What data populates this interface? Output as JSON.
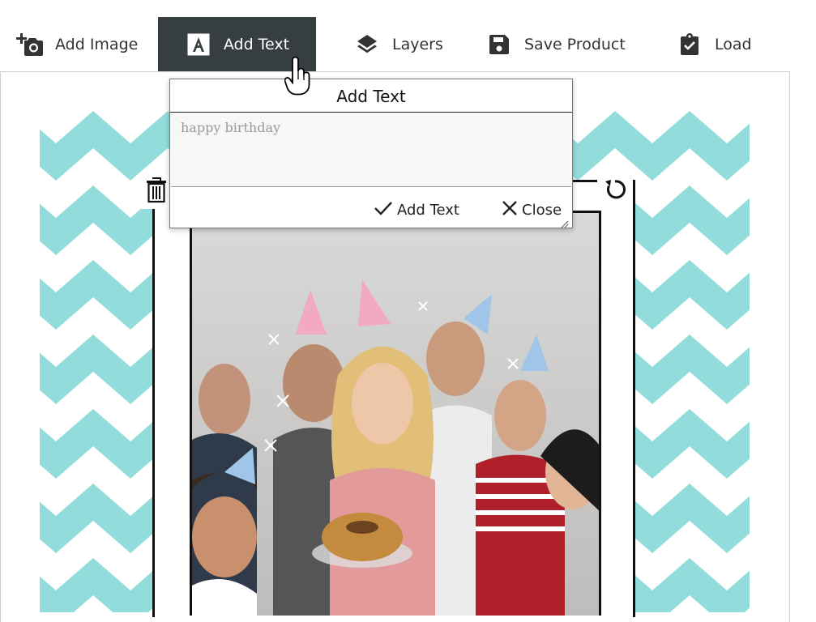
{
  "toolbar": {
    "items": [
      {
        "label": "Add Image",
        "icon": "add-photo-icon"
      },
      {
        "label": "Add Text",
        "icon": "text-box-icon",
        "active": true
      },
      {
        "label": "Layers",
        "icon": "layers-icon"
      },
      {
        "label": "Save Product",
        "icon": "floppy-disk-icon"
      },
      {
        "label": "Load",
        "icon": "clipboard-check-icon"
      }
    ],
    "active_color": "#373e42"
  },
  "dialog": {
    "title": "Add Text",
    "text_value": "happy birthday",
    "add_label": "Add Text",
    "close_label": "Close"
  },
  "canvas": {
    "pattern_color": "#92dddb",
    "tools": [
      "trash-icon",
      "rotate-icon"
    ]
  }
}
